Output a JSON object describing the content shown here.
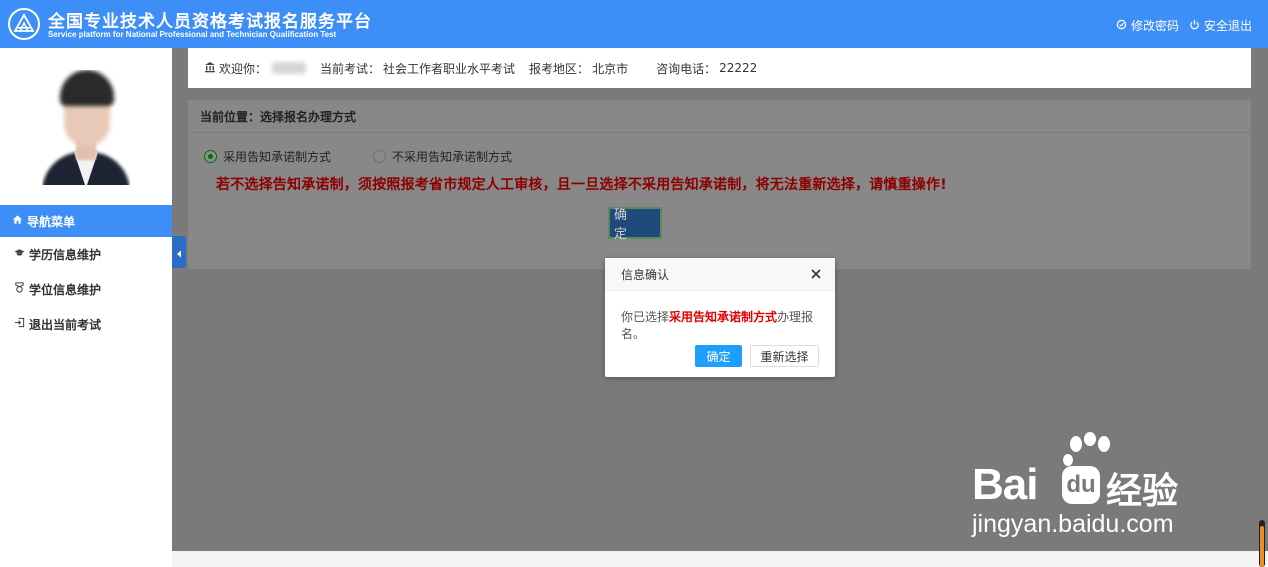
{
  "header": {
    "title_cn": "全国专业技术人员资格考试报名服务平台",
    "title_en": "Service platform for National Professional and Technician Qualification Test",
    "links": [
      {
        "label": "修改密码",
        "icon": "settings-icon"
      },
      {
        "label": "安全退出",
        "icon": "power-icon"
      }
    ]
  },
  "sidebar": {
    "nav_head": "导航菜单",
    "items": [
      {
        "label": "学历信息维护",
        "icon": "graduation-cap-icon"
      },
      {
        "label": "学位信息维护",
        "icon": "medal-icon"
      },
      {
        "label": "退出当前考试",
        "icon": "exit-icon"
      }
    ]
  },
  "topbar": {
    "welcome": "欢迎你：",
    "exam_label": "当前考试：",
    "exam_value": "社会工作者职业水平考试",
    "region_label": "报考地区：",
    "region_value": "北京市",
    "phone_label": "咨询电话：",
    "phone_value": "22222"
  },
  "panel": {
    "location": "当前位置：选择报名办理方式",
    "option_selected": "采用告知承诺制方式",
    "option_other": "不采用告知承诺制方式",
    "warning": "若不选择告知承诺制，须按照报考省市规定人工审核，且一旦选择不采用告知承诺制，将无法重新选择，请慎重操作!",
    "confirm_label": "确 定"
  },
  "dialog": {
    "title": "信息确认",
    "body_prefix": "你已选择",
    "body_emphasis": "采用告知承诺制方式",
    "body_suffix": "办理报名。",
    "ok_label": "确定",
    "reselect_label": "重新选择"
  },
  "watermark": {
    "brand_left": "Bai",
    "brand_box": "du",
    "brand_right": "经验",
    "url": "jingyan.baidu.com"
  },
  "colors": {
    "primary": "#3e8ef7",
    "dialog_ok": "#1e9fff",
    "warning": "#8b0000",
    "emphasis": "#e00000"
  }
}
